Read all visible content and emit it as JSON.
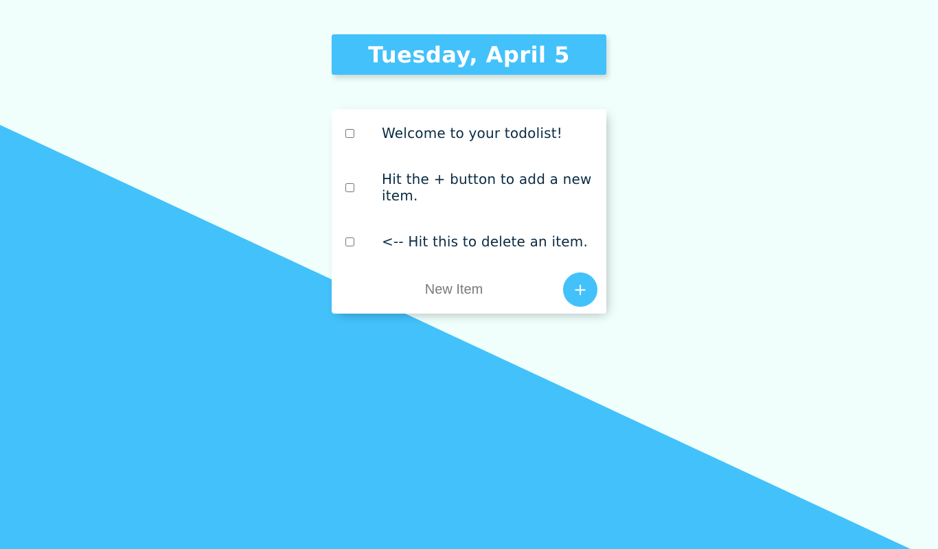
{
  "heading": {
    "date": "Tuesday, April 5"
  },
  "items": [
    {
      "label": "Welcome to your todolist!",
      "checked": false
    },
    {
      "label": "Hit the + button to add a new item.",
      "checked": false
    },
    {
      "label": "<-- Hit this to delete an item.",
      "checked": false
    }
  ],
  "new_item": {
    "placeholder": "New Item",
    "value": ""
  },
  "add_button": {
    "label": "+"
  },
  "colors": {
    "accent": "#43c1fb",
    "background": "#f0fffc",
    "text": "#0a2a42",
    "card": "#ffffff"
  }
}
